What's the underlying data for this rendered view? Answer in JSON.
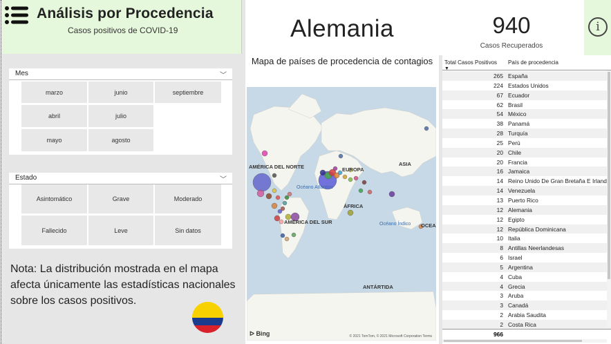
{
  "header": {
    "title": "Análisis por Procedencia",
    "subtitle": "Casos positivos de COVID-19"
  },
  "mes_slicer": {
    "label": "Mes",
    "options": [
      "marzo",
      "junio",
      "septiembre",
      "abril",
      "julio",
      "mayo",
      "agosto"
    ]
  },
  "estado_slicer": {
    "label": "Estado",
    "options": [
      "Asintomático",
      "Grave",
      "Moderado",
      "Fallecido",
      "Leve",
      "Sin datos"
    ]
  },
  "note": "Nota: La distribución mostrada en el mapa afecta únicamente las estadísticas nacionales sobre los casos positivos.",
  "country_card": {
    "value": "Alemania"
  },
  "kpi": {
    "value": "940",
    "label": "Casos Recuperados"
  },
  "map": {
    "title": "Mapa de países de procedencia de contagios",
    "labels": {
      "america_norte": "AMÉRICA DEL NORTE",
      "europa": "EUROPA",
      "asia": "ASIA",
      "africa": "ÁFRICA",
      "america_sur": "AMÉRICA DEL SUR",
      "oceano_atlantico": "Océano Atlántico",
      "oceano_indico": "Océano Índico",
      "oceania": "OCEA",
      "antartida": "ANTÁRTIDA"
    },
    "bing": "Bing",
    "copyright": "© 2021 TomTom, © 2021 Microsoft Corporation  Terms"
  },
  "table": {
    "col_total": "Total Casos Positivos",
    "col_country": "País de procedencia",
    "rows": [
      {
        "total": "265",
        "country": "España"
      },
      {
        "total": "224",
        "country": "Estados Unidos"
      },
      {
        "total": "67",
        "country": "Ecuador"
      },
      {
        "total": "62",
        "country": "Brasil"
      },
      {
        "total": "54",
        "country": "México"
      },
      {
        "total": "38",
        "country": "Panamá"
      },
      {
        "total": "28",
        "country": "Turquía"
      },
      {
        "total": "25",
        "country": "Perú"
      },
      {
        "total": "20",
        "country": "Chile"
      },
      {
        "total": "20",
        "country": "Francia"
      },
      {
        "total": "16",
        "country": "Jamaica"
      },
      {
        "total": "14",
        "country": "Reino Unido De Gran Bretaña E Irlanda"
      },
      {
        "total": "14",
        "country": "Venezuela"
      },
      {
        "total": "13",
        "country": "Puerto Rico"
      },
      {
        "total": "12",
        "country": "Alemania"
      },
      {
        "total": "12",
        "country": "Egipto"
      },
      {
        "total": "12",
        "country": "República Dominicana"
      },
      {
        "total": "10",
        "country": "Italia"
      },
      {
        "total": "8",
        "country": "Antillas Neerlandesas"
      },
      {
        "total": "6",
        "country": "Israel"
      },
      {
        "total": "5",
        "country": "Argentina"
      },
      {
        "total": "4",
        "country": "Cuba"
      },
      {
        "total": "4",
        "country": "Grecia"
      },
      {
        "total": "3",
        "country": "Aruba"
      },
      {
        "total": "3",
        "country": "Canadá"
      },
      {
        "total": "2",
        "country": "Arabia Saudita"
      },
      {
        "total": "2",
        "country": "Costa Rica"
      }
    ],
    "total": "966"
  },
  "colors": {
    "header_bg": "#e6f8dc",
    "flag_yellow": "#f7d200",
    "flag_blue": "#1b3b8f",
    "flag_red": "#d8212b"
  }
}
